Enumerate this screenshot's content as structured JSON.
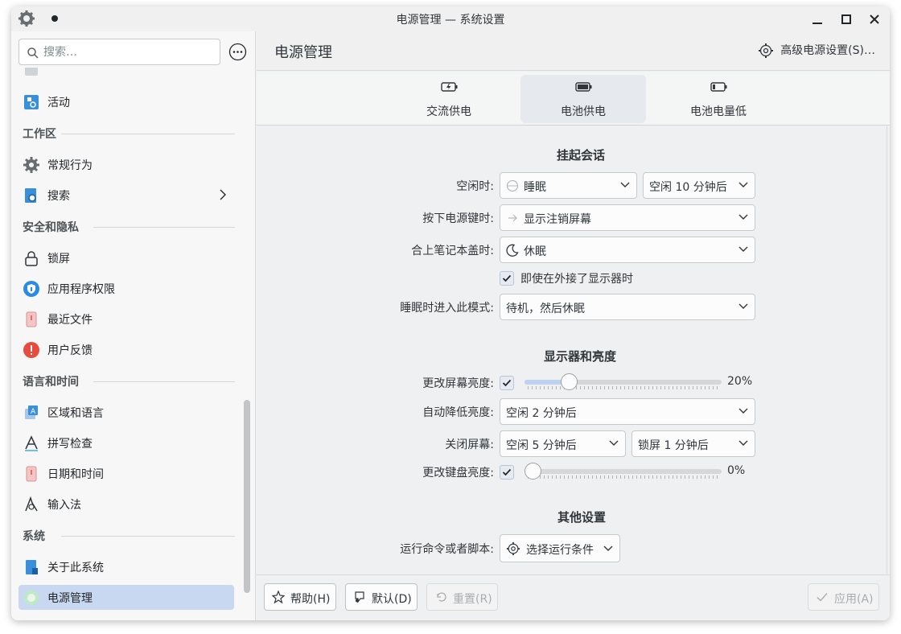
{
  "window": {
    "title": "电源管理 — 系统设置"
  },
  "sidebar": {
    "search_placeholder": "搜索…",
    "items": [
      {
        "label": "活动",
        "icon": "activities-icon"
      },
      {
        "category": "工作区"
      },
      {
        "label": "常规行为",
        "icon": "gear-icon"
      },
      {
        "label": "搜索",
        "icon": "search-icon"
      },
      {
        "category": "安全和隐私"
      },
      {
        "label": "锁屏",
        "icon": "lock-icon"
      },
      {
        "label": "应用程序权限",
        "icon": "shield-icon"
      },
      {
        "label": "最近文件",
        "icon": "recent-files-icon"
      },
      {
        "label": "用户反馈",
        "icon": "feedback-icon"
      },
      {
        "category": "语言和时间"
      },
      {
        "label": "区域和语言",
        "icon": "region-icon"
      },
      {
        "label": "拼写检查",
        "icon": "spellcheck-icon"
      },
      {
        "label": "日期和时间",
        "icon": "clock-icon"
      },
      {
        "label": "输入法",
        "icon": "input-method-icon"
      },
      {
        "category": "系统"
      },
      {
        "label": "关于此系统",
        "icon": "about-icon"
      },
      {
        "label": "电源管理",
        "icon": "power-icon",
        "active": true
      }
    ]
  },
  "header": {
    "title": "电源管理",
    "advanced_label": "高级电源设置(S)…"
  },
  "tabs": [
    {
      "label": "交流供电",
      "icon": "ac-power-icon"
    },
    {
      "label": "电池供电",
      "icon": "battery-icon",
      "active": true
    },
    {
      "label": "电池电量低",
      "icon": "battery-low-icon"
    }
  ],
  "suspend": {
    "title": "挂起会话",
    "idle_label": "空闲时:",
    "idle_action": "睡眠",
    "idle_delay": "空闲 10 分钟后",
    "power_button_label": "按下电源键时:",
    "power_button_action": "显示注销屏幕",
    "lid_label": "合上笔记本盖时:",
    "lid_action": "休眠",
    "external_monitor_label": "即使在外接了显示器时",
    "external_monitor_checked": true,
    "sleep_mode_label": "睡眠时进入此模式:",
    "sleep_mode_value": "待机，然后休眠"
  },
  "display": {
    "title": "显示器和亮度",
    "screen_brightness_label": "更改屏幕亮度:",
    "screen_brightness_checked": true,
    "screen_brightness_value": "20%",
    "screen_brightness_fraction": 0.2,
    "dim_label": "自动降低亮度:",
    "dim_value": "空闲 2 分钟后",
    "screen_off_label": "关闭屏幕:",
    "screen_off_idle": "空闲 5 分钟后",
    "screen_off_lock": "锁屏 1 分钟后",
    "keyboard_brightness_label": "更改键盘亮度:",
    "keyboard_brightness_checked": true,
    "keyboard_brightness_value": "0%",
    "keyboard_brightness_fraction": 0.0
  },
  "other": {
    "title": "其他设置",
    "script_label": "运行命令或者脚本:",
    "script_button": "选择运行条件"
  },
  "footer": {
    "help": "帮助(H)",
    "defaults": "默认(D)",
    "reset": "重置(R)",
    "apply": "应用(A)"
  },
  "colors": {
    "accent": "#3daee9",
    "active_item": "#c8d8f0"
  }
}
